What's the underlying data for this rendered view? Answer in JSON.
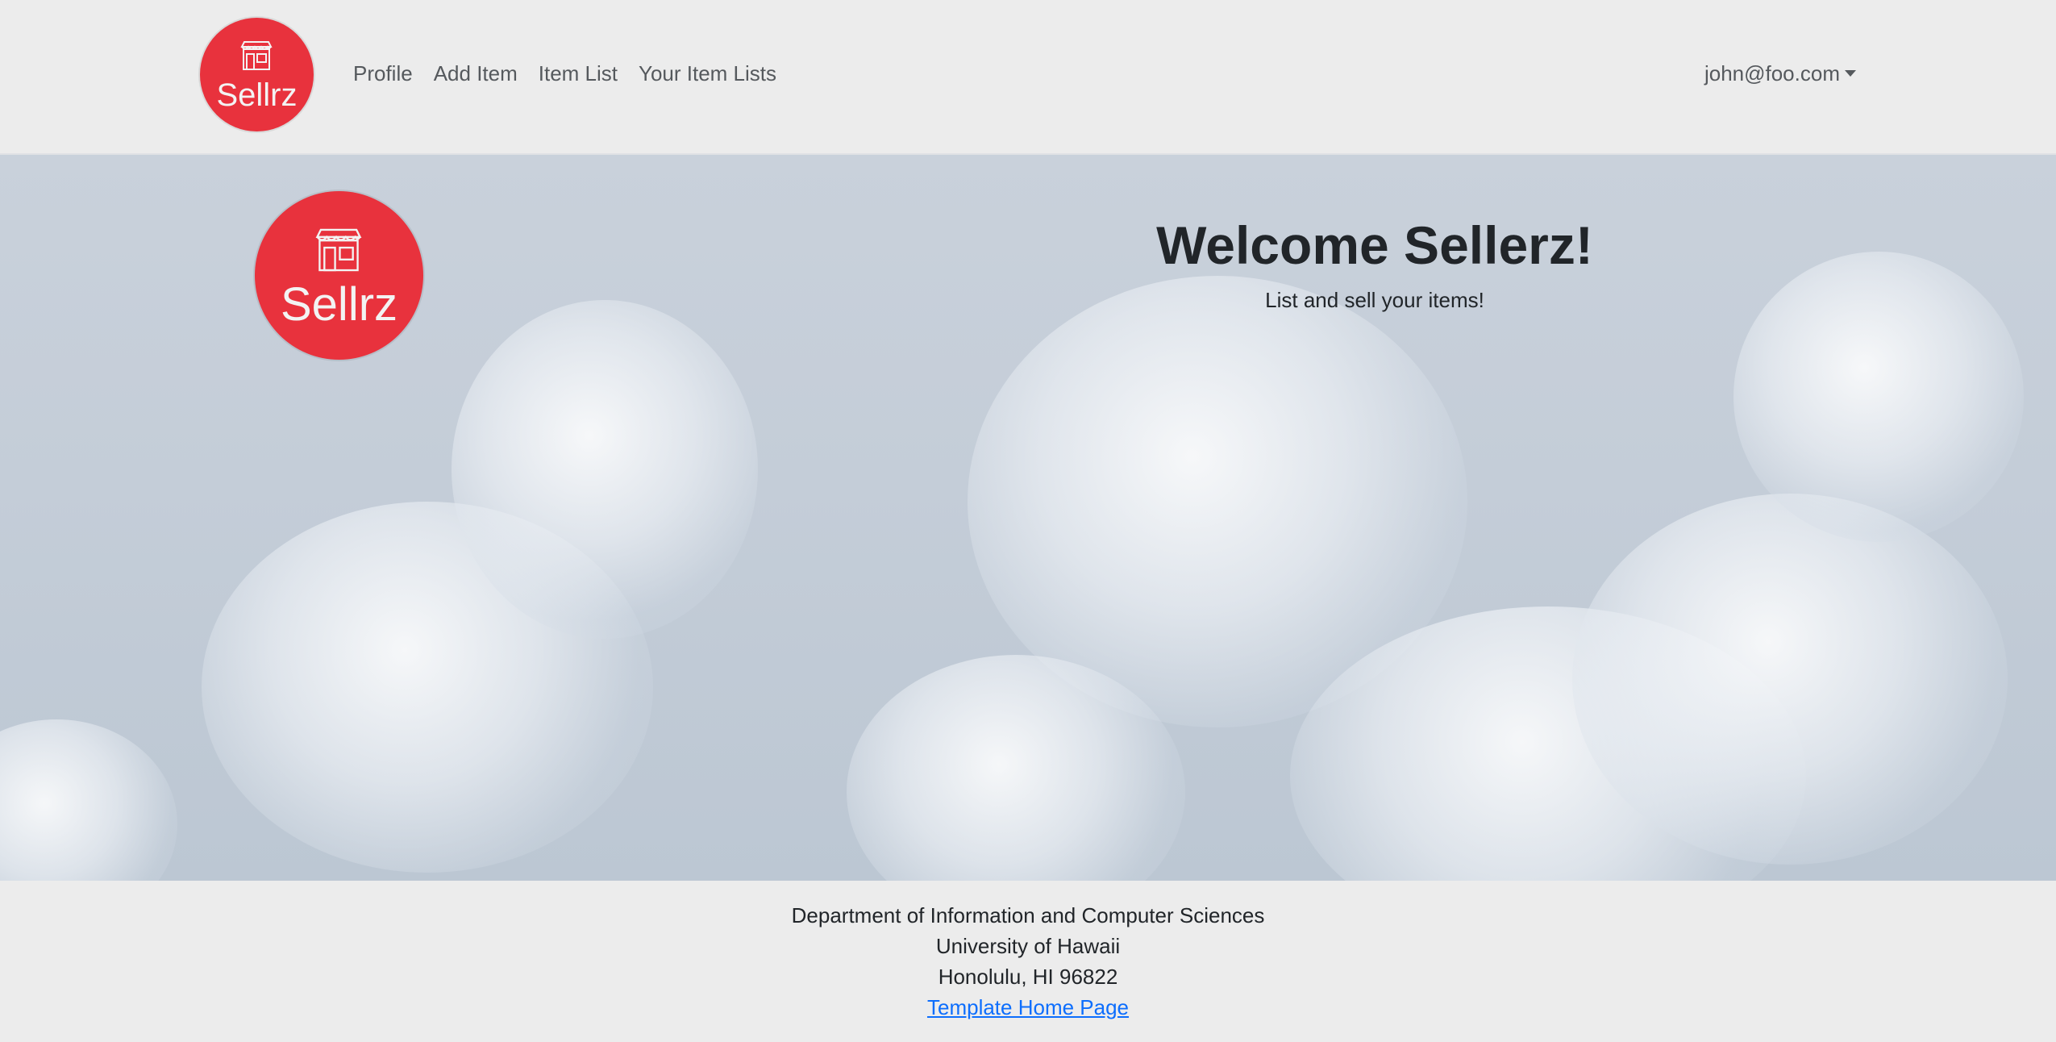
{
  "nav": {
    "logo_text": "Sellrz",
    "links": [
      {
        "label": "Profile"
      },
      {
        "label": "Add Item"
      },
      {
        "label": "Item List"
      },
      {
        "label": "Your Item Lists"
      }
    ],
    "user_email": "john@foo.com"
  },
  "hero": {
    "logo_text": "Sellrz",
    "title": "Welcome Sellerz!",
    "subtitle": "List and sell your items!"
  },
  "footer": {
    "department": "Department of Information and Computer Sciences",
    "university": "University of Hawaii",
    "address": "Honolulu, HI 96822",
    "link_label": "Template Home Page"
  },
  "colors": {
    "brand_red": "#e8323d",
    "link_blue": "#0d6efd",
    "nav_text": "#55595d",
    "background": "#ececec"
  }
}
